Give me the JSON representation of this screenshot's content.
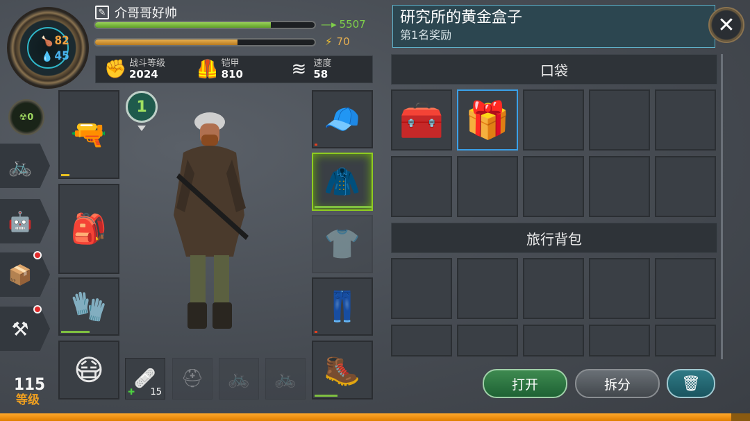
{
  "player": {
    "name": "介哥哥好帅",
    "food": "82",
    "water": "45",
    "radiation": "0",
    "level": "115",
    "level_label": "等级",
    "xp_value": "5507",
    "xp_fill": 0.8,
    "energy_value": "70",
    "energy_fill": 0.65
  },
  "stats": [
    {
      "label": "战斗等级",
      "value": "2024",
      "icon": "fist-icon"
    },
    {
      "label": "铠甲",
      "value": "810",
      "icon": "armor-vest-icon"
    },
    {
      "label": "速度",
      "value": "58",
      "icon": "speed-icon"
    }
  ],
  "character_level": "1",
  "left_equipment": [
    {
      "name": "weapon-slot",
      "icon": "rifle-icon",
      "glyph": "🔫",
      "durability": 0.15,
      "dur_color": "#e8c020"
    },
    {
      "name": "backpack-slot",
      "icon": "backpack-icon",
      "glyph": "🎒",
      "durability": 0,
      "dur_color": "#7fc040"
    },
    {
      "name": "gloves-slot",
      "icon": "gloves-icon",
      "glyph": "🧤",
      "durability": 0.5,
      "dur_color": "#7fc040"
    },
    {
      "name": "mask-slot",
      "icon": "gas-mask-icon",
      "glyph": "😷",
      "durability": 0,
      "dur_color": "#7fc040"
    }
  ],
  "right_equipment": [
    {
      "name": "head-slot",
      "icon": "cap-icon",
      "glyph": "🧢",
      "durability": 0.05,
      "dur_color": "#e04020"
    },
    {
      "name": "body-slot",
      "icon": "jacket-icon",
      "glyph": "🧥",
      "durability": 1.0,
      "dur_color": "#7fc040",
      "highlight": true
    },
    {
      "name": "shirt-slot",
      "icon": "shirt-icon",
      "glyph": "👕",
      "durability": 0,
      "dur_color": "#7fc040",
      "dim": true
    },
    {
      "name": "pants-slot",
      "icon": "pants-icon",
      "glyph": "👖",
      "durability": 0.05,
      "dur_color": "#e04020"
    },
    {
      "name": "boots-slot",
      "icon": "boots-icon",
      "glyph": "🥾",
      "durability": 0.4,
      "dur_color": "#7fc040"
    }
  ],
  "quick_slots": [
    {
      "name": "bandage-slot",
      "icon": "bandage-icon",
      "glyph": "🩹",
      "qty": "15",
      "dim": false
    },
    {
      "name": "medkit-slot",
      "icon": "medkit-icon",
      "glyph": "⛑",
      "qty": "",
      "dim": true
    },
    {
      "name": "vehicle-slot-1",
      "icon": "vehicle-icon",
      "glyph": "🚲",
      "qty": "",
      "dim": true
    },
    {
      "name": "vehicle-slot-2",
      "icon": "vehicle-icon",
      "glyph": "🚲",
      "qty": "",
      "dim": true
    }
  ],
  "side_menu": [
    {
      "name": "vehicle-button",
      "icon": "bicycle-icon",
      "glyph": "🚲",
      "notify": false
    },
    {
      "name": "pet-button",
      "icon": "robot-icon",
      "glyph": "🤖",
      "notify": false
    },
    {
      "name": "crate-button",
      "icon": "crate-icon",
      "glyph": "📦",
      "notify": true
    },
    {
      "name": "craft-button",
      "icon": "anvil-icon",
      "glyph": "⚒",
      "notify": true
    }
  ],
  "item_panel": {
    "title": "研究所的黄金盒子",
    "subtitle": "第1名奖励",
    "pocket_label": "口袋",
    "backpack_label": "旅行背包",
    "pocket_items": [
      {
        "name": "red-box",
        "icon": "red-crate-icon",
        "glyph": "🧰",
        "selected": false
      },
      {
        "name": "gold-box",
        "icon": "gold-crate-icon",
        "glyph": "🎁",
        "selected": true
      },
      null,
      null,
      null,
      null,
      null,
      null,
      null,
      null
    ],
    "backpack_items": [
      null,
      null,
      null,
      null,
      null,
      null,
      null,
      null,
      null,
      null
    ]
  },
  "buttons": {
    "open": "打开",
    "split": "拆分",
    "discard_icon": "trash-icon"
  },
  "bottom_progress": 0.975
}
